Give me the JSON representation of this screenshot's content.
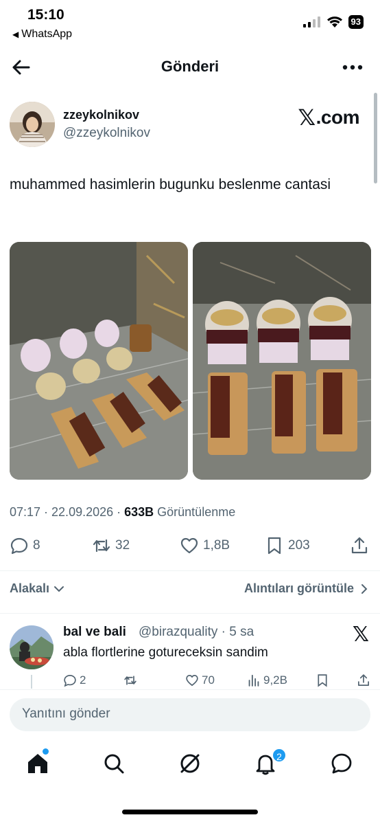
{
  "status_bar": {
    "time": "15:10",
    "back_app": "WhatsApp",
    "battery": "93"
  },
  "header": {
    "title": "Gönderi"
  },
  "post": {
    "author_name": "zzeykolnikov",
    "author_handle": "@zzeykolnikov",
    "source_label": ".com",
    "text": "muhammed hasimlerin bugunku beslenme cantasi",
    "time": "07:17 · 22.09.2026 · ",
    "views_count": "633B",
    "views_label": " Görüntülenme",
    "replies": "8",
    "reposts": "32",
    "likes": "1,8B",
    "bookmarks": "203"
  },
  "sort": {
    "label": "Alakalı",
    "quotes_label": "Alıntıları görüntüle"
  },
  "reply": {
    "author_name": "bal ve bali",
    "author_handle": "@birazquality · 5 sa",
    "text": "abla flortlerine gotureceksin sandim",
    "replies": "2",
    "reposts": "",
    "likes": "70",
    "views": "9,2B"
  },
  "composer": {
    "placeholder": "Yanıtını gönder"
  },
  "tabbar": {
    "notifications_badge": "2"
  },
  "colors": {
    "accent": "#1d9bf0",
    "text_primary": "#0f1419",
    "text_secondary": "#536471"
  },
  "icons": [
    "arrow-left-icon",
    "more-icon",
    "x-logo-icon",
    "reply-icon",
    "repost-icon",
    "like-icon",
    "bookmark-icon",
    "share-icon",
    "views-icon",
    "home-icon",
    "search-icon",
    "grok-icon",
    "bell-icon",
    "messages-icon"
  ]
}
